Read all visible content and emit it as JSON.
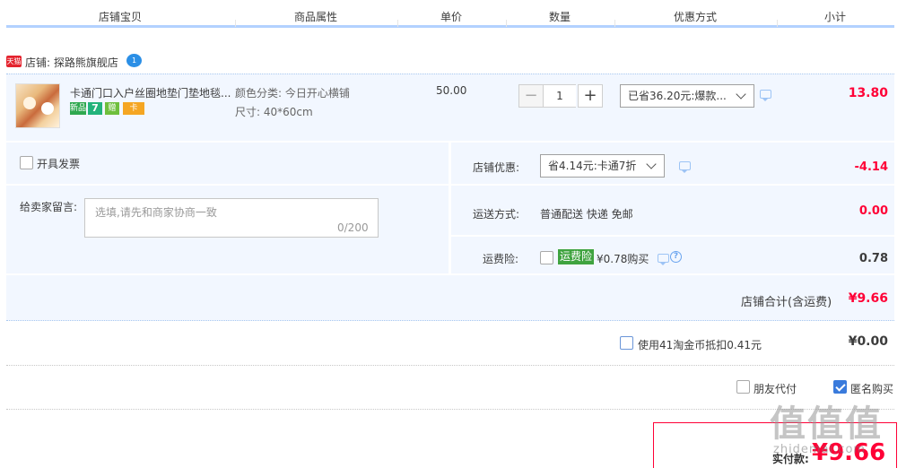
{
  "header": {
    "columns": [
      "店铺宝贝",
      "商品属性",
      "单价",
      "数量",
      "优惠方式",
      "小计"
    ]
  },
  "shop": {
    "badge": "天猫",
    "name": "店铺: 探路熊旗舰店",
    "chat_icon": "wangwang-icon"
  },
  "item": {
    "title": "卡通门口入户丝圈地垫门垫地毯...",
    "tags": [
      {
        "text": "新品",
        "color": "#2fa84f"
      },
      {
        "text": "7",
        "color": "#23b37b"
      },
      {
        "text": "赠",
        "color": "#6fbf3c"
      },
      {
        "text": "卡",
        "color": "#f5a623"
      }
    ],
    "attr_color": "颜色分类: 今日开心横铺",
    "attr_size": "尺寸: 40*60cm",
    "unit_price": "50.00",
    "quantity": "1",
    "minus": "−",
    "plus": "+",
    "promotion": "已省36.20元:爆款...",
    "subtotal": "13.80"
  },
  "options": {
    "invoice_label": "开具发票",
    "memo_label": "给卖家留言:",
    "memo_placeholder": "选填,请先和商家协商一致",
    "memo_count": "0/200",
    "shop_discount_label": "店铺优惠:",
    "shop_discount_select": "省4.14元:卡通7折",
    "shop_discount_value": "-4.14",
    "shipping_label": "运送方式:",
    "shipping_value": "普通配送 快递 免邮",
    "shipping_fee": "0.00",
    "insurance_label": "运费险:",
    "insurance_tag": "运费险",
    "insurance_text": "¥0.78购买",
    "insurance_value": "0.78",
    "help": "?"
  },
  "totals": {
    "shop_total_label": "店铺合计(含运费)",
    "shop_total_value": "¥9.66",
    "coin_label": "使用41淘金币抵扣0.41元",
    "coin_value": "¥0.00",
    "friend_pay_label": "朋友代付",
    "anonymous_label": "匿名购买",
    "anonymous_checked": true,
    "pay_label": "实付款:",
    "pay_amount": "¥9.66"
  },
  "watermark": {
    "logo": "值值值",
    "site": "zhidemai.com"
  },
  "colors": {
    "accent_red": "#ff0036",
    "row_bg": "#f2f7ff",
    "header_line": "#b2d1ff",
    "checkbox_blue": "#3a7bdc"
  }
}
